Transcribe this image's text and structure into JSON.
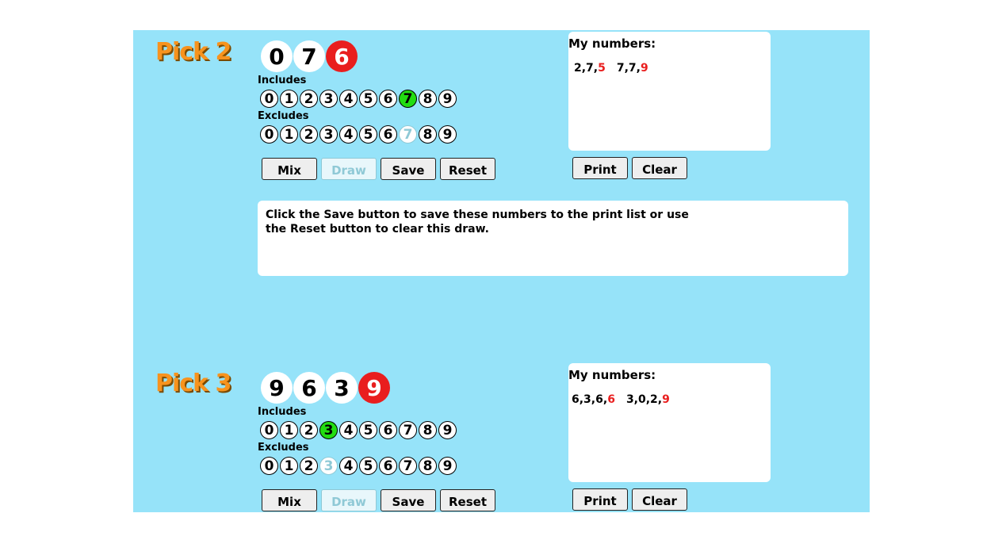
{
  "pick2": {
    "title": "Pick 2",
    "balls": [
      {
        "n": "0",
        "red": false
      },
      {
        "n": "7",
        "red": false
      },
      {
        "n": "6",
        "red": true
      }
    ],
    "includes_label": "Includes",
    "excludes_label": "Excludes",
    "digits": [
      "0",
      "1",
      "2",
      "3",
      "4",
      "5",
      "6",
      "7",
      "8",
      "9"
    ],
    "include_selected": "7",
    "exclude_disabled": "7",
    "buttons": {
      "mix": "Mix",
      "draw": "Draw",
      "save": "Save",
      "reset": "Reset"
    },
    "my_numbers": {
      "title": "My numbers:",
      "entries": [
        {
          "main": "2,7,",
          "extra": "5"
        },
        {
          "main": "7,7,",
          "extra": "9"
        }
      ],
      "print": "Print",
      "clear": "Clear"
    },
    "message": "Click the Save button to save these numbers to the print list or use the Reset button to clear this draw."
  },
  "pick3": {
    "title": "Pick 3",
    "balls": [
      {
        "n": "9",
        "red": false
      },
      {
        "n": "6",
        "red": false
      },
      {
        "n": "3",
        "red": false
      },
      {
        "n": "9",
        "red": true
      }
    ],
    "includes_label": "Includes",
    "excludes_label": "Excludes",
    "digits": [
      "0",
      "1",
      "2",
      "3",
      "4",
      "5",
      "6",
      "7",
      "8",
      "9"
    ],
    "include_selected": "3",
    "exclude_disabled": "3",
    "buttons": {
      "mix": "Mix",
      "draw": "Draw",
      "save": "Save",
      "reset": "Reset"
    },
    "my_numbers": {
      "title": "My numbers:",
      "entries": [
        {
          "main": "6,3,6,",
          "extra": "6"
        },
        {
          "main": "3,0,2,",
          "extra": "9"
        }
      ],
      "print": "Print",
      "clear": "Clear"
    }
  },
  "colors": {
    "panel": "#96e3f9",
    "title": "#f7931e",
    "red": "#e91e1e",
    "green": "#22dd11"
  }
}
